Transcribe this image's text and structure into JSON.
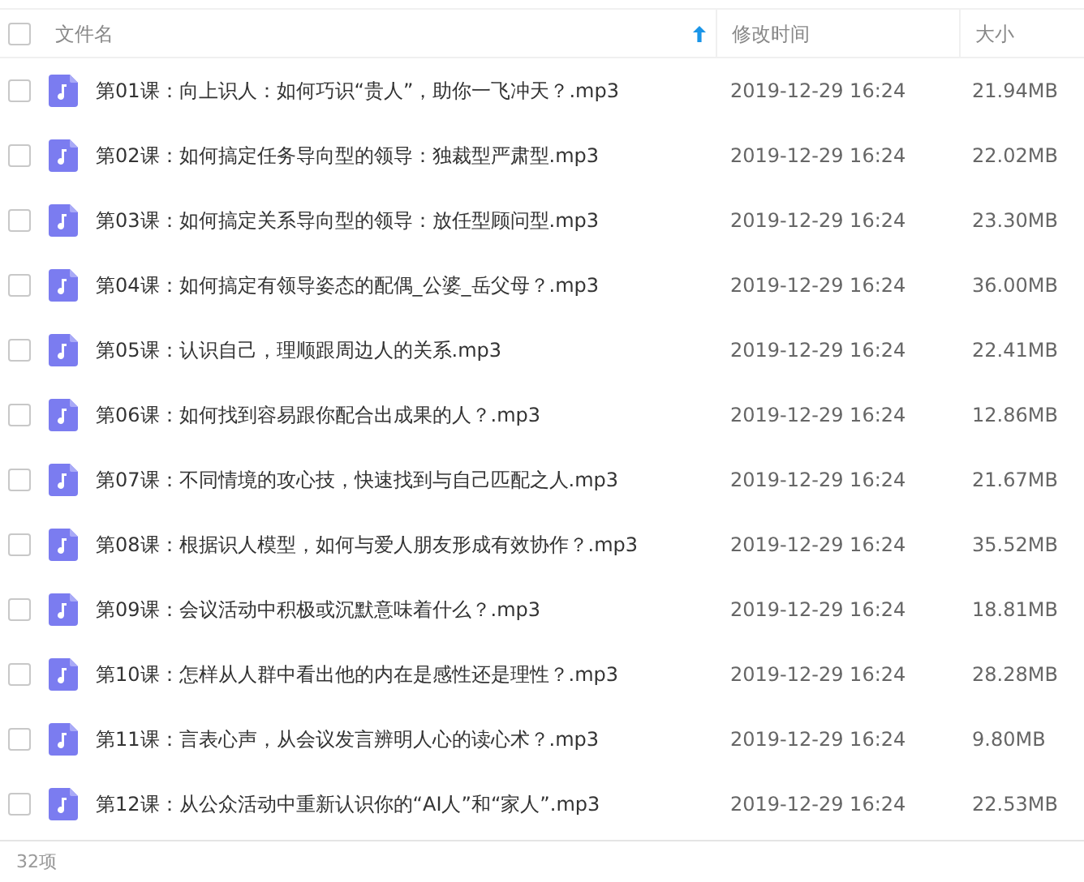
{
  "header": {
    "select_all": {
      "checked": false
    },
    "columns": [
      {
        "label": "文件名",
        "sorted": true
      },
      {
        "label": "修改时间"
      },
      {
        "label": "大小"
      }
    ]
  },
  "files": [
    {
      "name": "第01课：向上识人：如何巧识“贵人”，助你一飞冲天？.mp3",
      "modified": "2019-12-29 16:24",
      "size": "21.94MB",
      "checked": false
    },
    {
      "name": "第02课：如何搞定任务导向型的领导：独裁型严肃型.mp3",
      "modified": "2019-12-29 16:24",
      "size": "22.02MB",
      "checked": false
    },
    {
      "name": "第03课：如何搞定关系导向型的领导：放任型顾问型.mp3",
      "modified": "2019-12-29 16:24",
      "size": "23.30MB",
      "checked": false
    },
    {
      "name": "第04课：如何搞定有领导姿态的配偶_公婆_岳父母？.mp3",
      "modified": "2019-12-29 16:24",
      "size": "36.00MB",
      "checked": false
    },
    {
      "name": "第05课：认识自己，理顺跟周边人的关系.mp3",
      "modified": "2019-12-29 16:24",
      "size": "22.41MB",
      "checked": false
    },
    {
      "name": "第06课：如何找到容易跟你配合出成果的人？.mp3",
      "modified": "2019-12-29 16:24",
      "size": "12.86MB",
      "checked": false
    },
    {
      "name": "第07课：不同情境的攻心技，快速找到与自己匹配之人.mp3",
      "modified": "2019-12-29 16:24",
      "size": "21.67MB",
      "checked": false
    },
    {
      "name": "第08课：根据识人模型，如何与爱人朋友形成有效协作？.mp3",
      "modified": "2019-12-29 16:24",
      "size": "35.52MB",
      "checked": false
    },
    {
      "name": "第09课：会议活动中积极或沉默意味着什么？.mp3",
      "modified": "2019-12-29 16:24",
      "size": "18.81MB",
      "checked": false
    },
    {
      "name": "第10课：怎样从人群中看出他的内在是感性还是理性？.mp3",
      "modified": "2019-12-29 16:24",
      "size": "28.28MB",
      "checked": false
    },
    {
      "name": "第11课：言表心声，从会议发言辨明人心的读心术？.mp3",
      "modified": "2019-12-29 16:24",
      "size": "9.80MB",
      "checked": false
    },
    {
      "name": "第12课：从公众活动中重新认识你的“AI人”和“家人”.mp3",
      "modified": "2019-12-29 16:24",
      "size": "22.53MB",
      "checked": false
    }
  ],
  "status_bar": {
    "count": "32项"
  }
}
